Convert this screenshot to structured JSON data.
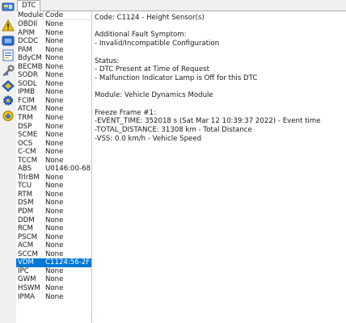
{
  "tabs": [
    {
      "label": "DTC"
    }
  ],
  "toolbar": {
    "icons": [
      "ecu-icon",
      "warning-icon",
      "module-icon",
      "report-icon",
      "wrench-icon",
      "diamond-icon",
      "gear-icon",
      "badge-icon"
    ]
  },
  "list": {
    "columns": [
      "Module",
      "Code"
    ],
    "rows": [
      {
        "module": "OBDII",
        "code": "None"
      },
      {
        "module": "APIM",
        "code": "None"
      },
      {
        "module": "DCDC",
        "code": "None"
      },
      {
        "module": "PAM",
        "code": "None"
      },
      {
        "module": "BdyCM",
        "code": "None"
      },
      {
        "module": "BECMB",
        "code": "None"
      },
      {
        "module": "SODR",
        "code": "None"
      },
      {
        "module": "SODL",
        "code": "None"
      },
      {
        "module": "IPMB",
        "code": "None"
      },
      {
        "module": "FCIM",
        "code": "None"
      },
      {
        "module": "ATCM",
        "code": "None"
      },
      {
        "module": "TRM",
        "code": "None"
      },
      {
        "module": "DSP",
        "code": "None"
      },
      {
        "module": "SCME",
        "code": "None"
      },
      {
        "module": "OCS",
        "code": "None"
      },
      {
        "module": "C-CM",
        "code": "None"
      },
      {
        "module": "TCCM",
        "code": "None"
      },
      {
        "module": "ABS",
        "code": "U0146:00-68"
      },
      {
        "module": "TrlrBM",
        "code": "None"
      },
      {
        "module": "TCU",
        "code": "None"
      },
      {
        "module": "RTM",
        "code": "None"
      },
      {
        "module": "DSM",
        "code": "None"
      },
      {
        "module": "PDM",
        "code": "None"
      },
      {
        "module": "DDM",
        "code": "None"
      },
      {
        "module": "RCM",
        "code": "None"
      },
      {
        "module": "PSCM",
        "code": "None"
      },
      {
        "module": "ACM",
        "code": "None"
      },
      {
        "module": "SCCM",
        "code": "None"
      },
      {
        "module": "VDM",
        "code": "C1124:56-2F",
        "selected": true
      },
      {
        "module": "IPC",
        "code": "None"
      },
      {
        "module": "GWM",
        "code": "None"
      },
      {
        "module": "HSWM",
        "code": "None"
      },
      {
        "module": "IPMA",
        "code": "None"
      }
    ]
  },
  "detail": {
    "lines": [
      "Code: C1124 - Height Sensor(s)",
      "",
      "Additional Fault Symptom:",
      " - Invalid/Incompatible Configuration",
      "",
      "Status:",
      " - DTC Present at Time of Request",
      " - Malfunction Indicator Lamp is Off for this DTC",
      "",
      "Module: Vehicle Dynamics Module",
      "",
      " Freeze Frame  #1:",
      "-EVENT_TIME: 352018 s (Sat Mar 12 10:39:37 2022) - Event time",
      "-TOTAL_DISTANCE: 31308 km - Total Distance",
      "-VSS: 0.0 km/h - Vehicle Speed"
    ]
  },
  "colors": {
    "selection": "#0078d7",
    "icon_blue": "#2f6fd6",
    "icon_yellow": "#f2c200"
  }
}
